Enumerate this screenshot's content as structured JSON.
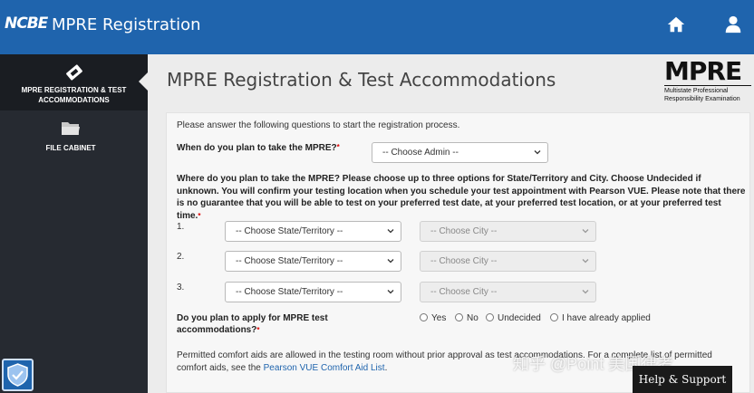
{
  "header": {
    "logo_text": "NCBE",
    "app_title": "MPRE Registration",
    "home_icon": "home-icon",
    "user_icon": "user-icon",
    "bar_color": "#1f64ad"
  },
  "sidebar": {
    "items": [
      {
        "label": "MPRE REGISTRATION & TEST ACCOMMODATIONS",
        "icon": "ticket-icon",
        "active": true
      },
      {
        "label": "FILE CABINET",
        "icon": "folder-icon",
        "active": false
      }
    ]
  },
  "main": {
    "title": "MPRE Registration & Test Accommodations",
    "mpre_logo": {
      "big": "MPRE",
      "small": "Multistate Professional Responsibility Examination"
    }
  },
  "form": {
    "intro": "Please answer the following questions to start the registration process.",
    "q1": {
      "label": "When do you plan to take the MPRE?",
      "required_mark": "*",
      "select_value": "-- Choose Admin --"
    },
    "q2": {
      "text": "Where do you plan to take the MPRE? Please choose up to three options for State/Territory and City. Choose Undecided if unknown. You will confirm your testing location when you schedule your test appointment with Pearson VUE. Please note that there is no guarantee that you will be able to test on your preferred test date, at your preferred test location, or at your preferred test time.",
      "required_mark": "*",
      "rows": [
        {
          "num": "1.",
          "state": "-- Choose State/Territory --",
          "city": "-- Choose City --"
        },
        {
          "num": "2.",
          "state": "-- Choose State/Territory --",
          "city": "-- Choose City --"
        },
        {
          "num": "3.",
          "state": "-- Choose State/Territory --",
          "city": "-- Choose City --"
        }
      ]
    },
    "q3": {
      "label": "Do you plan to apply for MPRE test accommodations?",
      "required_mark": "*",
      "options": [
        "Yes",
        "No",
        "Undecided",
        "I have already applied"
      ]
    },
    "comfort": {
      "text_before": "Permitted comfort aids are allowed in the testing room without prior approval as test accommodations. For a complete list of permitted comfort aids, see the ",
      "link": "Pearson VUE Comfort Aid List",
      "text_after": "."
    }
  },
  "overlay": {
    "help_label": "Help & Support",
    "watermark": "知乎 @Point 美国律考"
  }
}
